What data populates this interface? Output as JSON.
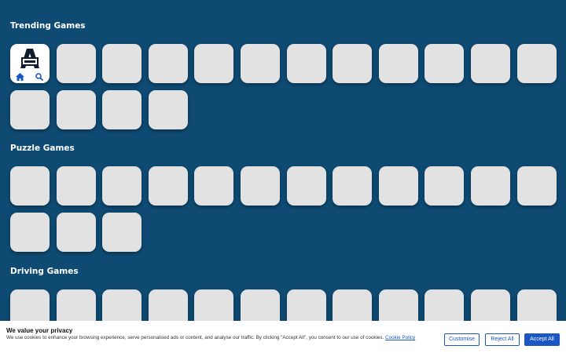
{
  "sections": [
    {
      "title": "Trending Games",
      "tile_count": 16
    },
    {
      "title": "Puzzle Games",
      "tile_count": 15
    },
    {
      "title": "Driving Games",
      "tile_count": 12
    }
  ],
  "home_tile": {
    "logo_icon": "site-logo-icon",
    "home_icon": "home-icon",
    "search_icon": "search-icon"
  },
  "colors": {
    "page_bg": "#0e4a72",
    "tile_bg": "#e2e2e2",
    "accent": "#1a56c4"
  },
  "consent": {
    "title": "We value your privacy",
    "text": "We use cookies to enhance your browsing experience, serve personalised ads or content, and analyse our traffic. By clicking \"Accept All\", you consent to our use of cookies.",
    "link": "Cookie Policy",
    "customise": "Customise",
    "reject": "Reject All",
    "accept": "Accept All"
  }
}
